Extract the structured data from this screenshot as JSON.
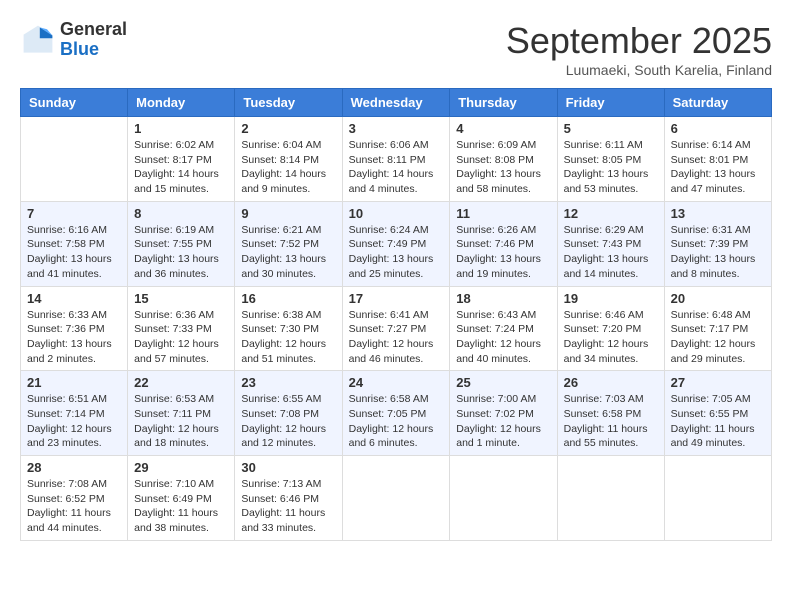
{
  "header": {
    "logo": {
      "general": "General",
      "blue": "Blue"
    },
    "title": "September 2025",
    "subtitle": "Luumaeki, South Karelia, Finland"
  },
  "weekdays": [
    "Sunday",
    "Monday",
    "Tuesday",
    "Wednesday",
    "Thursday",
    "Friday",
    "Saturday"
  ],
  "weeks": [
    [
      {
        "day": "",
        "info": ""
      },
      {
        "day": "1",
        "info": "Sunrise: 6:02 AM\nSunset: 8:17 PM\nDaylight: 14 hours\nand 15 minutes."
      },
      {
        "day": "2",
        "info": "Sunrise: 6:04 AM\nSunset: 8:14 PM\nDaylight: 14 hours\nand 9 minutes."
      },
      {
        "day": "3",
        "info": "Sunrise: 6:06 AM\nSunset: 8:11 PM\nDaylight: 14 hours\nand 4 minutes."
      },
      {
        "day": "4",
        "info": "Sunrise: 6:09 AM\nSunset: 8:08 PM\nDaylight: 13 hours\nand 58 minutes."
      },
      {
        "day": "5",
        "info": "Sunrise: 6:11 AM\nSunset: 8:05 PM\nDaylight: 13 hours\nand 53 minutes."
      },
      {
        "day": "6",
        "info": "Sunrise: 6:14 AM\nSunset: 8:01 PM\nDaylight: 13 hours\nand 47 minutes."
      }
    ],
    [
      {
        "day": "7",
        "info": "Sunrise: 6:16 AM\nSunset: 7:58 PM\nDaylight: 13 hours\nand 41 minutes."
      },
      {
        "day": "8",
        "info": "Sunrise: 6:19 AM\nSunset: 7:55 PM\nDaylight: 13 hours\nand 36 minutes."
      },
      {
        "day": "9",
        "info": "Sunrise: 6:21 AM\nSunset: 7:52 PM\nDaylight: 13 hours\nand 30 minutes."
      },
      {
        "day": "10",
        "info": "Sunrise: 6:24 AM\nSunset: 7:49 PM\nDaylight: 13 hours\nand 25 minutes."
      },
      {
        "day": "11",
        "info": "Sunrise: 6:26 AM\nSunset: 7:46 PM\nDaylight: 13 hours\nand 19 minutes."
      },
      {
        "day": "12",
        "info": "Sunrise: 6:29 AM\nSunset: 7:43 PM\nDaylight: 13 hours\nand 14 minutes."
      },
      {
        "day": "13",
        "info": "Sunrise: 6:31 AM\nSunset: 7:39 PM\nDaylight: 13 hours\nand 8 minutes."
      }
    ],
    [
      {
        "day": "14",
        "info": "Sunrise: 6:33 AM\nSunset: 7:36 PM\nDaylight: 13 hours\nand 2 minutes."
      },
      {
        "day": "15",
        "info": "Sunrise: 6:36 AM\nSunset: 7:33 PM\nDaylight: 12 hours\nand 57 minutes."
      },
      {
        "day": "16",
        "info": "Sunrise: 6:38 AM\nSunset: 7:30 PM\nDaylight: 12 hours\nand 51 minutes."
      },
      {
        "day": "17",
        "info": "Sunrise: 6:41 AM\nSunset: 7:27 PM\nDaylight: 12 hours\nand 46 minutes."
      },
      {
        "day": "18",
        "info": "Sunrise: 6:43 AM\nSunset: 7:24 PM\nDaylight: 12 hours\nand 40 minutes."
      },
      {
        "day": "19",
        "info": "Sunrise: 6:46 AM\nSunset: 7:20 PM\nDaylight: 12 hours\nand 34 minutes."
      },
      {
        "day": "20",
        "info": "Sunrise: 6:48 AM\nSunset: 7:17 PM\nDaylight: 12 hours\nand 29 minutes."
      }
    ],
    [
      {
        "day": "21",
        "info": "Sunrise: 6:51 AM\nSunset: 7:14 PM\nDaylight: 12 hours\nand 23 minutes."
      },
      {
        "day": "22",
        "info": "Sunrise: 6:53 AM\nSunset: 7:11 PM\nDaylight: 12 hours\nand 18 minutes."
      },
      {
        "day": "23",
        "info": "Sunrise: 6:55 AM\nSunset: 7:08 PM\nDaylight: 12 hours\nand 12 minutes."
      },
      {
        "day": "24",
        "info": "Sunrise: 6:58 AM\nSunset: 7:05 PM\nDaylight: 12 hours\nand 6 minutes."
      },
      {
        "day": "25",
        "info": "Sunrise: 7:00 AM\nSunset: 7:02 PM\nDaylight: 12 hours\nand 1 minute."
      },
      {
        "day": "26",
        "info": "Sunrise: 7:03 AM\nSunset: 6:58 PM\nDaylight: 11 hours\nand 55 minutes."
      },
      {
        "day": "27",
        "info": "Sunrise: 7:05 AM\nSunset: 6:55 PM\nDaylight: 11 hours\nand 49 minutes."
      }
    ],
    [
      {
        "day": "28",
        "info": "Sunrise: 7:08 AM\nSunset: 6:52 PM\nDaylight: 11 hours\nand 44 minutes."
      },
      {
        "day": "29",
        "info": "Sunrise: 7:10 AM\nSunset: 6:49 PM\nDaylight: 11 hours\nand 38 minutes."
      },
      {
        "day": "30",
        "info": "Sunrise: 7:13 AM\nSunset: 6:46 PM\nDaylight: 11 hours\nand 33 minutes."
      },
      {
        "day": "",
        "info": ""
      },
      {
        "day": "",
        "info": ""
      },
      {
        "day": "",
        "info": ""
      },
      {
        "day": "",
        "info": ""
      }
    ]
  ]
}
